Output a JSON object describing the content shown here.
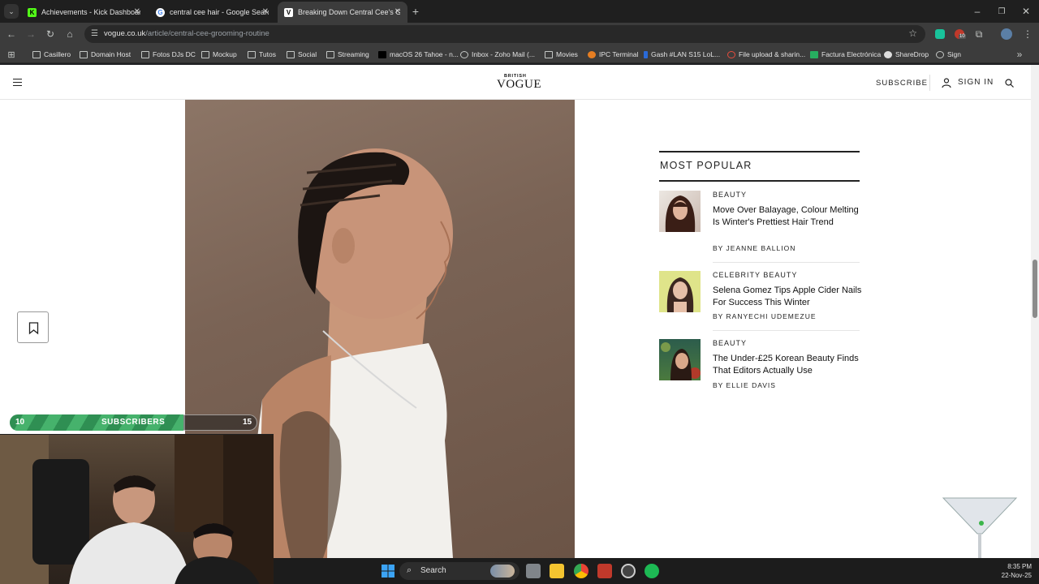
{
  "browser": {
    "tabs": [
      {
        "title": "Achievements - Kick Dashboard",
        "icon": "kick-icon",
        "active": false
      },
      {
        "title": "central cee hair - Google Search",
        "icon": "google-icon",
        "active": false
      },
      {
        "title": "Breaking Down Central Cee's Gr",
        "icon": "vogue-icon",
        "active": true
      }
    ],
    "url_domain": "vogue.co.uk",
    "url_path": "/article/central-cee-grooming-routine",
    "extension_badge": "10",
    "bookmarks": [
      "Casillero",
      "Domain Host",
      "Fotos DJs DC",
      "Mockup",
      "Tutos",
      "Social",
      "Streaming",
      "macOS 26 Tahoe - n...",
      "Inbox - Zoho Mail (...",
      "Movies",
      "IPC Terminal",
      "Gash #LAN S15 LoL...",
      "File upload & sharin...",
      "Factura Electrónica",
      "ShareDrop",
      "Sign"
    ]
  },
  "site": {
    "logo_small": "BRITISH",
    "logo_main": "VOGUE",
    "subscribe": "SUBSCRIBE",
    "sign_in": "SIGN IN"
  },
  "most_popular": {
    "title": "MOST POPULAR",
    "items": [
      {
        "category": "BEAUTY",
        "headline": "Move Over Balayage, Colour Melting Is Winter's Prettiest Hair Trend",
        "byline": "BY JEANNE BALLION"
      },
      {
        "category": "CELEBRITY BEAUTY",
        "headline": "Selena Gomez Tips Apple Cider Nails For Success This Winter",
        "byline": "BY RANYECHI UDEMEZUE"
      },
      {
        "category": "BEAUTY",
        "headline": "The Under-£25 Korean Beauty Finds That Editors Actually Use",
        "byline": "BY ELLIE DAVIS"
      }
    ]
  },
  "overlay": {
    "sub_left": "10",
    "sub_label": "SUBSCRIBERS",
    "sub_right": "15",
    "sub_progress": 0.7
  },
  "taskbar": {
    "search_label": "Search",
    "time": "8:35 PM",
    "date": "22-Nov-25"
  },
  "colors": {
    "accent_green": "#46b26c",
    "page_bg": "#ffffff",
    "chrome_bg": "#3c3c3c"
  }
}
